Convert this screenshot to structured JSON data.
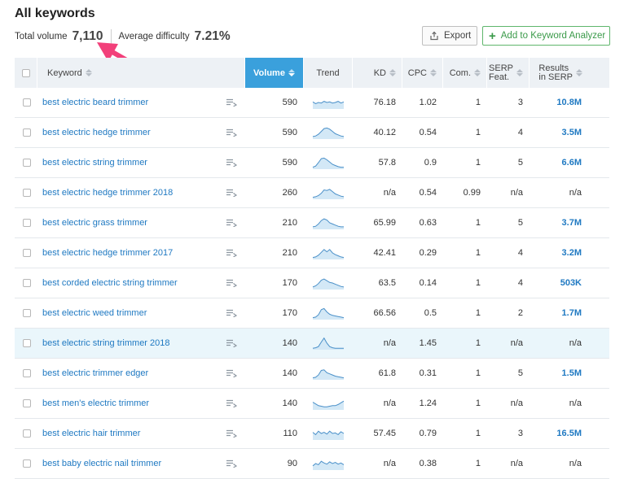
{
  "header": {
    "title": "All keywords",
    "total_volume_label": "Total volume",
    "total_volume_value": "7,110",
    "avg_difficulty_label": "Average difficulty",
    "avg_difficulty_value": "7.21%"
  },
  "toolbar": {
    "export_label": "Export",
    "add_label": "Add to Keyword Analyzer"
  },
  "colors": {
    "accent": "#3aa0dc",
    "link": "#1f79c2",
    "highlight_row": "#eaf6fb",
    "annotation_arrow": "#f2407a",
    "add_button": "#3a9a49"
  },
  "table": {
    "columns": {
      "keyword": "Keyword",
      "volume": "Volume",
      "trend": "Trend",
      "kd": "KD",
      "cpc": "CPC",
      "com": "Com.",
      "serp_1": "SERP",
      "serp_2": "Feat.",
      "results_1": "Results",
      "results_2": "in SERP"
    },
    "sorted_column": "volume",
    "rows": [
      {
        "keyword": "best electric beard trimmer",
        "volume": "590",
        "trend": [
          0.55,
          0.4,
          0.5,
          0.45,
          0.6,
          0.5,
          0.55,
          0.45,
          0.5,
          0.6,
          0.45,
          0.55
        ],
        "kd": "76.18",
        "cpc": "1.02",
        "com": "1",
        "serp": "3",
        "results": "10.8M"
      },
      {
        "keyword": "best electric hedge trimmer",
        "volume": "590",
        "trend": [
          0.15,
          0.2,
          0.35,
          0.6,
          0.85,
          0.9,
          0.8,
          0.6,
          0.4,
          0.3,
          0.2,
          0.15
        ],
        "kd": "40.12",
        "cpc": "0.54",
        "com": "1",
        "serp": "4",
        "results": "3.5M"
      },
      {
        "keyword": "best electric string trimmer",
        "volume": "590",
        "trend": [
          0.1,
          0.2,
          0.5,
          0.85,
          0.9,
          0.75,
          0.55,
          0.35,
          0.25,
          0.15,
          0.1,
          0.1
        ],
        "kd": "57.8",
        "cpc": "0.9",
        "com": "1",
        "serp": "5",
        "results": "6.6M"
      },
      {
        "keyword": "best electric hedge trimmer 2018",
        "volume": "260",
        "trend": [
          0.1,
          0.15,
          0.25,
          0.45,
          0.75,
          0.7,
          0.8,
          0.6,
          0.4,
          0.3,
          0.2,
          0.15
        ],
        "kd": "n/a",
        "cpc": "0.54",
        "com": "0.99",
        "serp": "n/a",
        "results": "n/a"
      },
      {
        "keyword": "best electric grass trimmer",
        "volume": "210",
        "trend": [
          0.15,
          0.2,
          0.4,
          0.7,
          0.85,
          0.75,
          0.5,
          0.4,
          0.3,
          0.2,
          0.15,
          0.15
        ],
        "kd": "65.99",
        "cpc": "0.63",
        "com": "1",
        "serp": "5",
        "results": "3.7M"
      },
      {
        "keyword": "best electric hedge trimmer 2017",
        "volume": "210",
        "trend": [
          0.1,
          0.15,
          0.3,
          0.55,
          0.8,
          0.6,
          0.8,
          0.5,
          0.35,
          0.25,
          0.15,
          0.1
        ],
        "kd": "42.41",
        "cpc": "0.29",
        "com": "1",
        "serp": "4",
        "results": "3.2M"
      },
      {
        "keyword": "best corded electric string trimmer",
        "volume": "170",
        "trend": [
          0.15,
          0.25,
          0.45,
          0.75,
          0.85,
          0.7,
          0.55,
          0.5,
          0.4,
          0.3,
          0.2,
          0.15
        ],
        "kd": "63.5",
        "cpc": "0.14",
        "com": "1",
        "serp": "4",
        "results": "503K"
      },
      {
        "keyword": "best electric weed trimmer",
        "volume": "170",
        "trend": [
          0.1,
          0.15,
          0.35,
          0.8,
          0.9,
          0.6,
          0.4,
          0.3,
          0.25,
          0.2,
          0.15,
          0.1
        ],
        "kd": "66.56",
        "cpc": "0.5",
        "com": "1",
        "serp": "2",
        "results": "1.7M"
      },
      {
        "keyword": "best electric string trimmer 2018",
        "volume": "140",
        "trend": [
          0.05,
          0.1,
          0.2,
          0.6,
          0.95,
          0.5,
          0.2,
          0.1,
          0.05,
          0.05,
          0.05,
          0.05
        ],
        "kd": "n/a",
        "cpc": "1.45",
        "com": "1",
        "serp": "n/a",
        "results": "n/a",
        "highlight": true
      },
      {
        "keyword": "best electric trimmer edger",
        "volume": "140",
        "trend": [
          0.1,
          0.15,
          0.35,
          0.75,
          0.8,
          0.55,
          0.45,
          0.35,
          0.25,
          0.2,
          0.15,
          0.1
        ],
        "kd": "61.8",
        "cpc": "0.31",
        "com": "1",
        "serp": "5",
        "results": "1.5M"
      },
      {
        "keyword": "best men's electric trimmer",
        "volume": "140",
        "trend": [
          0.6,
          0.45,
          0.3,
          0.25,
          0.2,
          0.2,
          0.25,
          0.3,
          0.3,
          0.4,
          0.55,
          0.7
        ],
        "kd": "n/a",
        "cpc": "1.24",
        "com": "1",
        "serp": "n/a",
        "results": "n/a"
      },
      {
        "keyword": "best electric hair trimmer",
        "volume": "110",
        "trend": [
          0.6,
          0.4,
          0.7,
          0.5,
          0.6,
          0.45,
          0.7,
          0.5,
          0.55,
          0.4,
          0.65,
          0.5
        ],
        "kd": "57.45",
        "cpc": "0.79",
        "com": "1",
        "serp": "3",
        "results": "16.5M"
      },
      {
        "keyword": "best baby electric nail trimmer",
        "volume": "90",
        "trend": [
          0.3,
          0.5,
          0.4,
          0.7,
          0.55,
          0.45,
          0.65,
          0.5,
          0.6,
          0.45,
          0.55,
          0.4
        ],
        "kd": "n/a",
        "cpc": "0.38",
        "com": "1",
        "serp": "n/a",
        "results": "n/a"
      }
    ]
  }
}
